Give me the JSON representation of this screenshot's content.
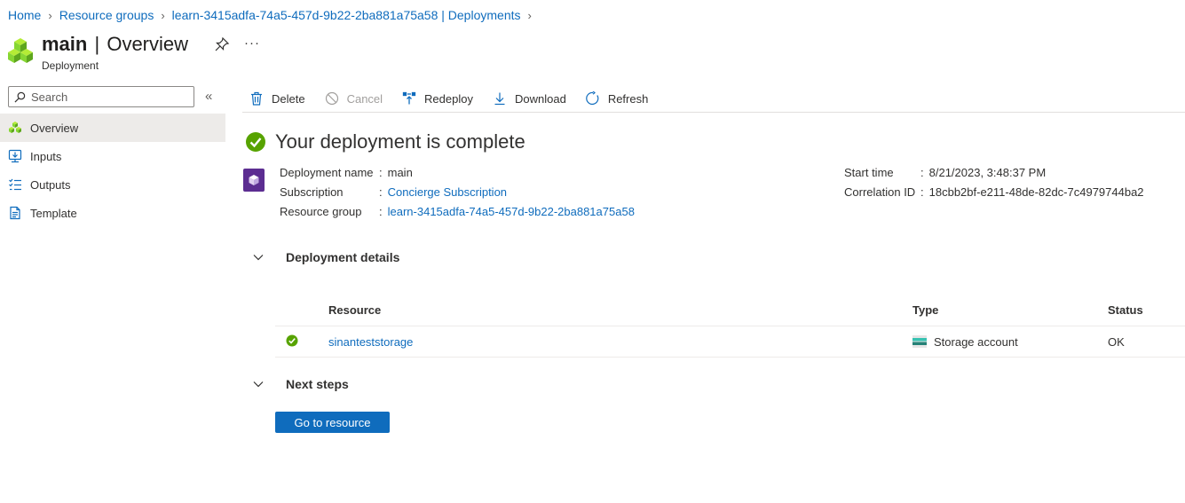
{
  "breadcrumb": [
    "Home",
    "Resource groups",
    "learn-3415adfa-74a5-457d-9b22-2ba881a75a58 | Deployments"
  ],
  "header": {
    "title_bold": "main",
    "title_sep": "|",
    "title_rest": "Overview",
    "subtitle": "Deployment",
    "more_label": "···"
  },
  "search": {
    "placeholder": "Search",
    "collapse_label": "«"
  },
  "sidebar": {
    "items": [
      {
        "label": "Overview",
        "icon": "cubes-icon",
        "active": true
      },
      {
        "label": "Inputs",
        "icon": "inputs-icon",
        "active": false
      },
      {
        "label": "Outputs",
        "icon": "outputs-icon",
        "active": false
      },
      {
        "label": "Template",
        "icon": "template-icon",
        "active": false
      }
    ]
  },
  "toolbar": {
    "delete": "Delete",
    "cancel": "Cancel",
    "redeploy": "Redeploy",
    "download": "Download",
    "refresh": "Refresh"
  },
  "status": {
    "title": "Your deployment is complete"
  },
  "info_left": [
    {
      "label": "Deployment name",
      "colon": ":",
      "value": "main",
      "is_link": false
    },
    {
      "label": "Subscription",
      "colon": ":",
      "value": "Concierge Subscription",
      "is_link": true
    },
    {
      "label": "Resource group",
      "colon": ":",
      "value": "learn-3415adfa-74a5-457d-9b22-2ba881a75a58",
      "is_link": true
    }
  ],
  "info_right": [
    {
      "label": "Start time",
      "colon": ":",
      "value": "8/21/2023, 3:48:37 PM"
    },
    {
      "label": "Correlation ID",
      "colon": ":",
      "value": "18cbb2bf-e211-48de-82dc-7c4979744ba2"
    }
  ],
  "deployment_details": {
    "heading": "Deployment details",
    "columns": {
      "resource": "Resource",
      "type": "Type",
      "status": "Status"
    },
    "rows": [
      {
        "resource": "sinanteststorage",
        "type": "Storage account",
        "status": "OK"
      }
    ]
  },
  "next_steps": {
    "heading": "Next steps",
    "button": "Go to resource"
  },
  "colors": {
    "link": "#0f6cbd",
    "success": "#57a300",
    "primary_button": "#0f6cbd",
    "deployment_icon": "#5c2d91"
  }
}
